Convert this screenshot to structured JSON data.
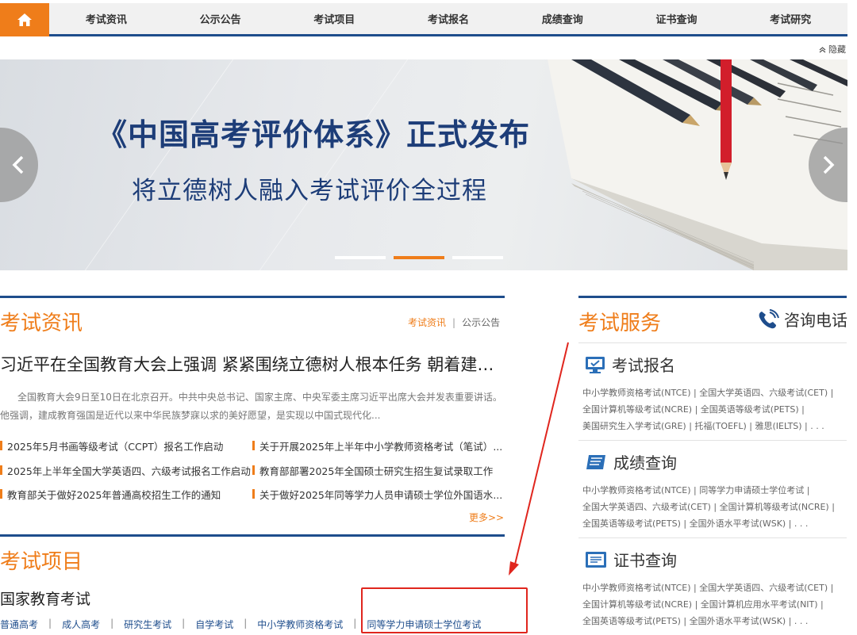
{
  "nav": {
    "home_icon": "home-icon",
    "items": [
      "考试资讯",
      "公示公告",
      "考试项目",
      "考试报名",
      "成绩查询",
      "证书查询",
      "考试研究"
    ]
  },
  "hide_label": "隐藏",
  "banner": {
    "title": "《中国高考评价体系》正式发布",
    "subtitle": "将立德树人融入考试评价全过程",
    "active_slide": 2,
    "slide_count": 3
  },
  "news_section": {
    "title": "考试资讯",
    "tab_active": "考试资讯",
    "tab_other": "公示公告",
    "headline": "习近平在全国教育大会上强调 紧紧围绕立德树人根本任务 朝着建…",
    "summary": "全国教育大会9日至10日在北京召开。中共中央总书记、国家主席、中央军委主席习近平出席大会并发表重要讲话。他强调，建成教育强国是近代以来中华民族梦寐以求的美好愿望，是实现以中国式现代化...",
    "items": [
      "2025年5月书画等级考试（CCPT）报名工作启动",
      "关于开展2025年上半年中小学教师资格考试（笔试）...",
      "2025年上半年全国大学英语四、六级考试报名工作启动",
      "教育部部署2025年全国硕士研究生招生复试录取工作",
      "教育部关于做好2025年普通高校招生工作的通知",
      "关于做好2025年同等学力人员申请硕士学位外国语水..."
    ],
    "more": "更多>>"
  },
  "projects_section": {
    "title": "考试项目",
    "category": "国家教育考试",
    "links": [
      "普通高考",
      "成人高考",
      "研究生考试",
      "自学考试",
      "中小学教师资格考试",
      "同等学力申请硕士学位考试"
    ]
  },
  "service_section": {
    "title": "考试服务",
    "phone_label": "咨询电话",
    "blocks": [
      {
        "icon": "monitor-icon",
        "title": "考试报名",
        "lines": [
          "中小学教师资格考试(NTCE) | 全国大学英语四、六级考试(CET) |",
          "全国计算机等级考试(NCRE) | 全国英语等级考试(PETS) |",
          "美国研究生入学考试(GRE) | 托福(TOEFL) | 雅思(IELTS) | . . ."
        ]
      },
      {
        "icon": "document-icon",
        "title": "成绩查询",
        "lines": [
          "中小学教师资格考试(NTCE) | 同等学力申请硕士学位考试 |",
          "全国大学英语四、六级考试(CET) | 全国计算机等级考试(NCRE) |",
          "全国英语等级考试(PETS) | 全国外语水平考试(WSK) | . . ."
        ]
      },
      {
        "icon": "certificate-icon",
        "title": "证书查询",
        "lines": [
          "中小学教师资格考试(NTCE) | 全国大学英语四、六级考试(CET) |",
          "全国计算机等级考试(NCRE) | 全国计算机应用水平考试(NIT) |",
          "全国英语等级考试(PETS) | 全国外语水平考试(WSK) | . . ."
        ]
      }
    ]
  },
  "colors": {
    "accent_orange": "#ef7d1a",
    "nav_blue": "#1e4d8c",
    "banner_text": "#1d3d78",
    "annotation_red": "#e0261e"
  }
}
